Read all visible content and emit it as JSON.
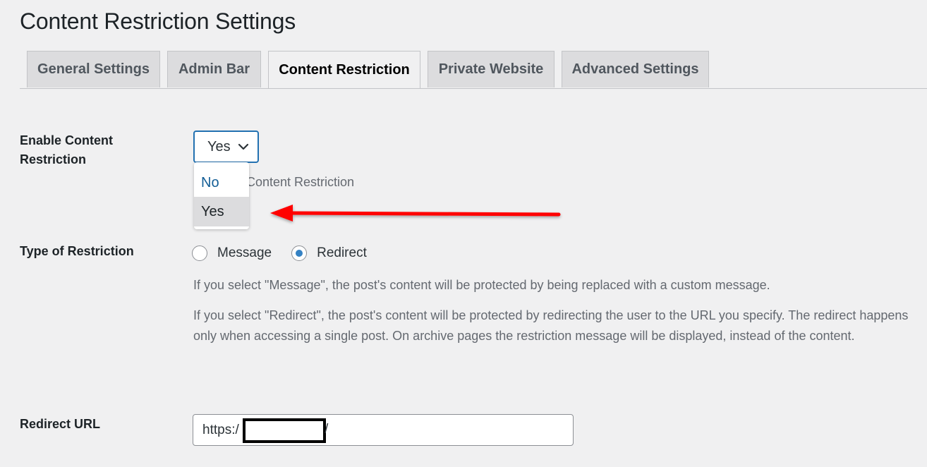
{
  "page": {
    "title": "Content Restriction Settings"
  },
  "tabs": [
    {
      "label": "General Settings",
      "active": false
    },
    {
      "label": "Admin Bar",
      "active": false
    },
    {
      "label": "Content Restriction",
      "active": true
    },
    {
      "label": "Private Website",
      "active": false
    },
    {
      "label": "Advanced Settings",
      "active": false
    }
  ],
  "enable_restriction": {
    "label": "Enable Content Restriction",
    "selected_value": "Yes",
    "description_partial": "Content Restriction",
    "dropdown_open": true,
    "options": [
      {
        "label": "No",
        "highlighted": false
      },
      {
        "label": "Yes",
        "highlighted": true
      }
    ]
  },
  "annotation": {
    "arrow_color": "#ff0000",
    "arrow_direction": "left",
    "points_to": "Yes option"
  },
  "type_of_restriction": {
    "label": "Type of Restriction",
    "options": [
      {
        "label": "Message",
        "checked": false
      },
      {
        "label": "Redirect",
        "checked": true
      }
    ],
    "help_message": "If you select \"Message\", the post's content will be protected by being replaced with a custom message.",
    "help_redirect": "If you select \"Redirect\", the post's content will be protected by redirecting the user to the URL you specify. The redirect happens only when accessing a single post. On archive pages the restriction message will be displayed, instead of the content."
  },
  "redirect_url": {
    "label": "Redirect URL",
    "value_prefix": "https:/",
    "value_suffix": "/",
    "value_redacted": true
  },
  "colors": {
    "accent": "#2271b1",
    "radio_checked": "#3582c4",
    "background": "#f0f0f1",
    "tab_inactive": "#dcdcde"
  }
}
